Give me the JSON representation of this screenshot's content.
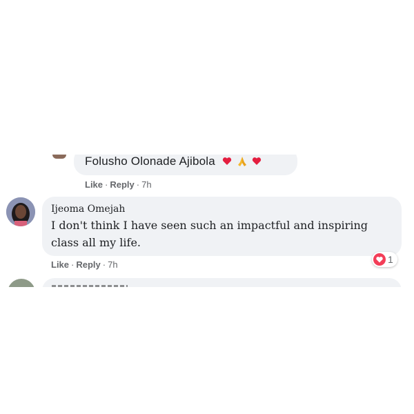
{
  "comments": [
    {
      "author": "Folusho Olonade Ajibola",
      "emojis": [
        "red-heart",
        "folded-hands",
        "red-heart"
      ],
      "actions": {
        "like": "Like",
        "reply": "Reply",
        "separator": "·",
        "time": "7h"
      }
    },
    {
      "author": "Ijeoma Omejah",
      "text": "I don't think I have seen such an impactful and inspiring class all my life.",
      "reaction": {
        "icon": "love-reaction-icon",
        "count": "1"
      },
      "actions": {
        "like": "Like",
        "reply": "Reply",
        "separator": "·",
        "time": "7h"
      }
    }
  ],
  "colors": {
    "bubble": "#f0f2f5",
    "meta_text": "#65676b",
    "heart": "#e41e3f"
  }
}
